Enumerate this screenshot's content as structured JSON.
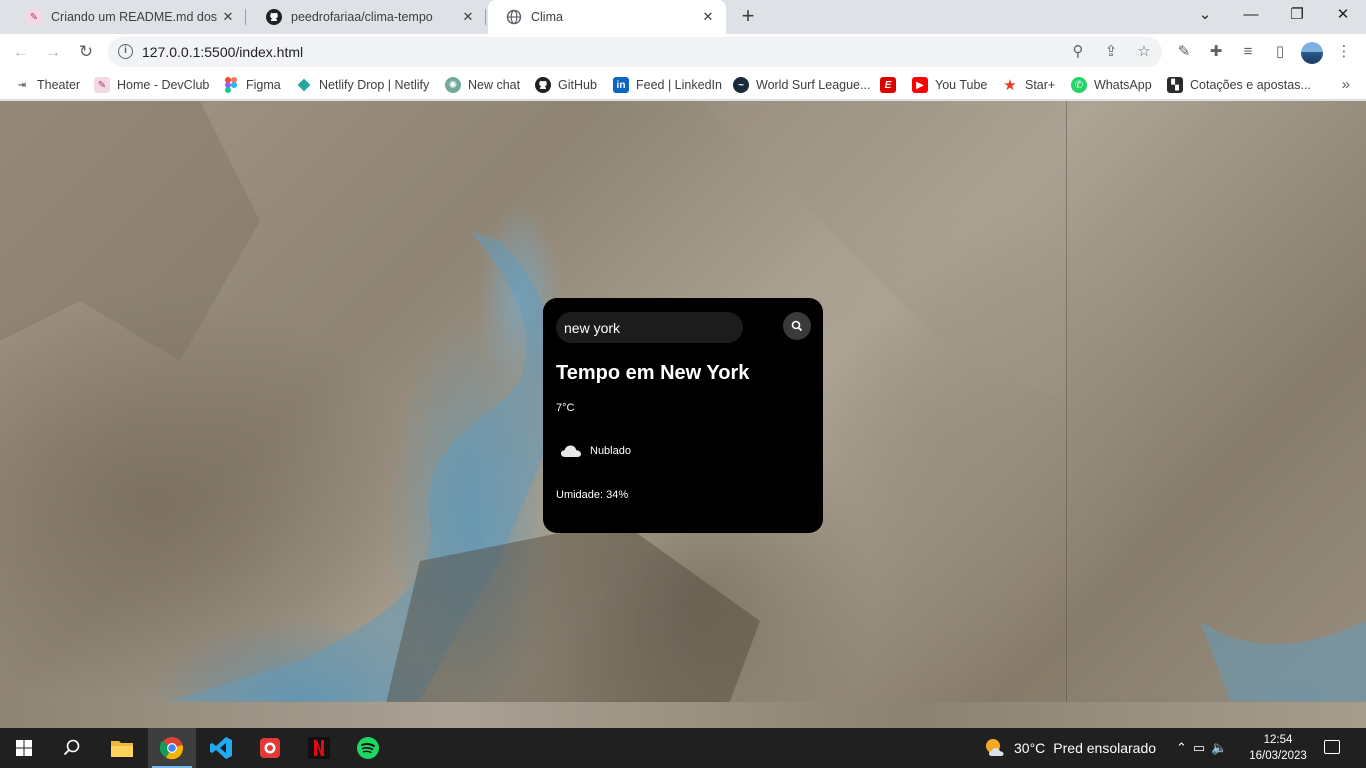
{
  "browser": {
    "tabs": [
      {
        "title": "Criando um README.md dos pro",
        "icon": "readme-favicon"
      },
      {
        "title": "peedrofariaa/clima-tempo",
        "icon": "github-icon"
      },
      {
        "title": "Clima",
        "icon": "globe-icon"
      }
    ],
    "url": "127.0.0.1:5500/index.html",
    "bookmarks": [
      {
        "label": "Theater",
        "icon": "theater-icon"
      },
      {
        "label": "Home - DevClub",
        "icon": "devclub-icon"
      },
      {
        "label": "Figma",
        "icon": "figma-icon"
      },
      {
        "label": "Netlify Drop | Netlify",
        "icon": "netlify-icon"
      },
      {
        "label": "New chat",
        "icon": "openai-icon"
      },
      {
        "label": "GitHub",
        "icon": "github-icon"
      },
      {
        "label": "Feed | LinkedIn",
        "icon": "linkedin-icon"
      },
      {
        "label": "World Surf League...",
        "icon": "wsl-icon"
      },
      {
        "label": "",
        "icon": "espn-icon"
      },
      {
        "label": "You Tube",
        "icon": "youtube-icon"
      },
      {
        "label": "Star+",
        "icon": "star-plus-icon"
      },
      {
        "label": "WhatsApp",
        "icon": "whatsapp-icon"
      },
      {
        "label": "Cotações e apostas...",
        "icon": "bet-icon"
      }
    ]
  },
  "weather": {
    "search_value": "new york",
    "city_title": "Tempo em New York",
    "temperature": "7°C",
    "description": "Nublado",
    "humidity": "Umidade: 34%"
  },
  "taskbar": {
    "weather_temp": "30°C",
    "weather_desc": "Pred ensolarado",
    "time": "12:54",
    "date": "16/03/2023"
  },
  "colors": {
    "card_bg": "#000000",
    "search_bg": "#1c1c1c",
    "taskbar_bg": "#202020"
  }
}
